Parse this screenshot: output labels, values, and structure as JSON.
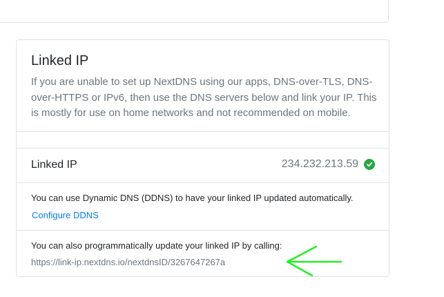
{
  "linked_ip_card": {
    "title": "Linked IP",
    "description": "If you are unable to set up NextDNS using our apps, DNS-over-TLS, DNS-over-HTTPS or IPv6, then use the DNS servers below and link your IP. This is mostly for use on home networks and not recommended on mobile.",
    "linked_ip_row": {
      "label": "Linked IP",
      "ip": "234.232.213.59",
      "status_icon": "check-circle-icon",
      "status_color": "#28a745"
    },
    "ddns": {
      "text": "You can use Dynamic DNS (DDNS) to have your linked IP updated automatically.",
      "link_label": "Configure DDNS",
      "link_color": "#007bff"
    },
    "api": {
      "text": "You can also programmatically update your linked IP by calling:",
      "url": "https://link-ip.nextdns.io/nextdnsID/3267647267a"
    }
  },
  "annotation": {
    "icon": "arrow-left-icon",
    "color": "#22ee22"
  }
}
